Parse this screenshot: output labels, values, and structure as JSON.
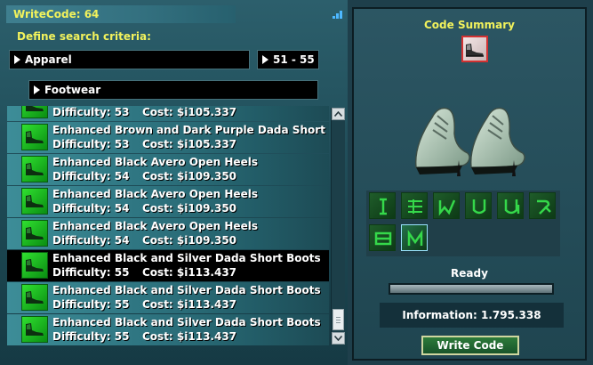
{
  "window": {
    "title": "WriteCode: 64"
  },
  "search": {
    "label": "Define search criteria:",
    "category": "Apparel",
    "level_range": "51 - 55",
    "subcategory": "Footwear"
  },
  "list": {
    "items": [
      {
        "name": "",
        "difficulty": "Difficulty: 53",
        "cost": "Cost: $i105.337",
        "selected": false
      },
      {
        "name": "Enhanced Brown and Dark Purple Dada Short Boots",
        "difficulty": "Difficulty: 53",
        "cost": "Cost: $i105.337",
        "selected": false
      },
      {
        "name": "Enhanced Black Avero Open Heels",
        "difficulty": "Difficulty: 54",
        "cost": "Cost: $i109.350",
        "selected": false
      },
      {
        "name": "Enhanced Black Avero Open Heels",
        "difficulty": "Difficulty: 54",
        "cost": "Cost: $i109.350",
        "selected": false
      },
      {
        "name": "Enhanced Black Avero Open Heels",
        "difficulty": "Difficulty: 54",
        "cost": "Cost: $i109.350",
        "selected": false
      },
      {
        "name": "Enhanced Black and Silver Dada Short Boots",
        "difficulty": "Difficulty: 55",
        "cost": "Cost: $i113.437",
        "selected": true
      },
      {
        "name": "Enhanced Black and Silver Dada Short Boots",
        "difficulty": "Difficulty: 55",
        "cost": "Cost: $i113.437",
        "selected": false
      },
      {
        "name": "Enhanced Black and Silver Dada Short Boots",
        "difficulty": "Difficulty: 55",
        "cost": "Cost: $i113.437",
        "selected": false
      }
    ]
  },
  "summary": {
    "title": "Code Summary",
    "status": "Ready",
    "progress": 1.0,
    "information": "Information: 1.795.338",
    "write_button": "Write Code",
    "enhancements": [
      {
        "icon": "enhancement-i-icon",
        "highlighted": false
      },
      {
        "icon": "enhancement-lines-icon",
        "highlighted": false
      },
      {
        "icon": "enhancement-w-icon",
        "highlighted": false
      },
      {
        "icon": "enhancement-u-icon",
        "highlighted": false
      },
      {
        "icon": "enhancement-u-bar-icon",
        "highlighted": false
      },
      {
        "icon": "enhancement-y-icon",
        "highlighted": false
      },
      {
        "icon": "enhancement-box-icon",
        "highlighted": false
      },
      {
        "icon": "enhancement-wedge-icon",
        "highlighted": true
      }
    ]
  },
  "colors": {
    "accent_yellow": "#f2f25c",
    "item_icon_green": "#22c22a",
    "selected_row": "#000000"
  }
}
